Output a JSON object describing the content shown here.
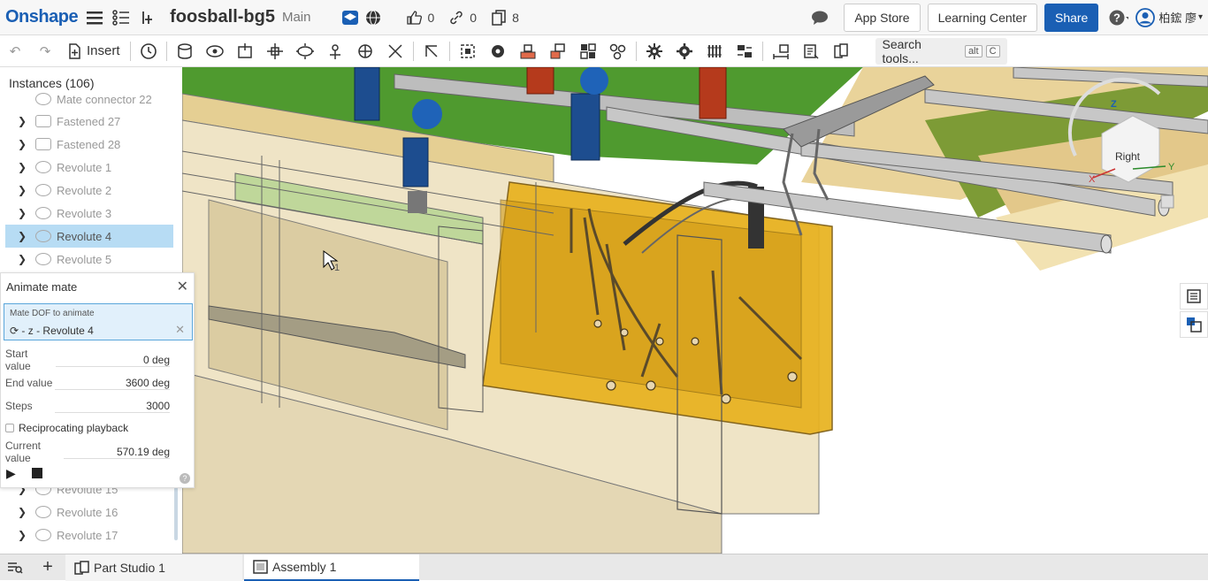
{
  "header": {
    "logo": "Onshape",
    "document_title": "foosball-bg5",
    "branch": "Main",
    "likes": "0",
    "links": "0",
    "copies": "8",
    "app_store": "App Store",
    "learning_center": "Learning Center",
    "share": "Share",
    "user_name": "柏鋐 廖"
  },
  "toolbar": {
    "insert_label": "Insert",
    "search_label": "Search tools...",
    "kbd_alt": "alt",
    "kbd_c": "C"
  },
  "sidebar": {
    "instances_title": "Instances (106)",
    "items": [
      {
        "label": "Mate connector 22"
      },
      {
        "label": "Fastened 27"
      },
      {
        "label": "Fastened 28"
      },
      {
        "label": "Revolute 1"
      },
      {
        "label": "Revolute 2"
      },
      {
        "label": "Revolute 3"
      },
      {
        "label": "Revolute 4"
      },
      {
        "label": "Revolute 5"
      },
      {
        "label": "Revolute 15"
      },
      {
        "label": "Revolute 16"
      },
      {
        "label": "Revolute 17"
      }
    ]
  },
  "animate": {
    "title": "Animate mate",
    "mate_dof_label": "Mate DOF to animate",
    "mate_dof_value": "- z - Revolute 4",
    "start_label": "Start value",
    "start_value": "0 deg",
    "end_label": "End value",
    "end_value": "3600 deg",
    "steps_label": "Steps",
    "steps_value": "3000",
    "reciprocating_label": "Reciprocating playback",
    "current_label": "Current value",
    "current_value": "570.19 deg"
  },
  "viewcube": {
    "right": "Right",
    "z": "Z",
    "x": "X",
    "y": "Y"
  },
  "cursor_label": "1",
  "bottom": {
    "tab1": "Part Studio 1",
    "tab2": "Assembly 1"
  },
  "colors": {
    "accent": "#1a5fb4",
    "selection": "#b7dcf4",
    "field_green": "#4f9a2f",
    "wood": "#e3c88a",
    "amber": "#e8b21e"
  }
}
